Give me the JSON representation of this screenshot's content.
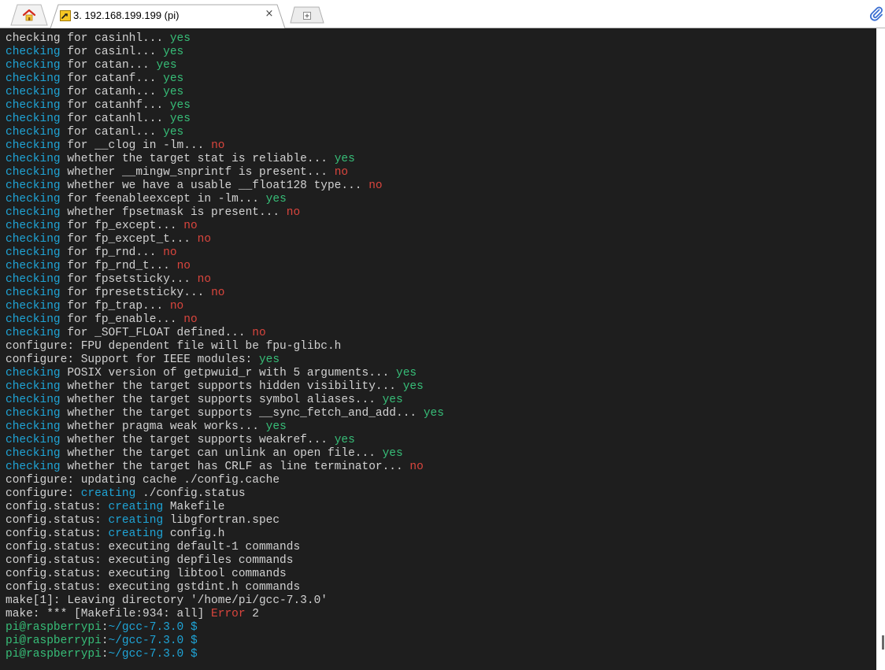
{
  "window": {
    "tab_title": "3. 192.168.199.199 (pi)",
    "close_glyph": "×",
    "icons": {
      "home": "home-icon",
      "session": "terminal-session-icon",
      "new_tab": "new-tab-icon",
      "attach": "paperclip-icon"
    }
  },
  "colors": {
    "background": "#1e1e1e",
    "text": "#d2d2d2",
    "keyword": "#1fa4d6",
    "yes": "#37be78",
    "no": "#d9453d"
  },
  "terminal": {
    "lines": [
      [
        {
          "t": "checking",
          "c": "plain"
        },
        {
          "t": " for casinhl... ",
          "c": "plain"
        },
        {
          "t": "yes",
          "c": "yes"
        }
      ],
      [
        {
          "t": "checking",
          "c": "kw"
        },
        {
          "t": " for casinl... ",
          "c": "plain"
        },
        {
          "t": "yes",
          "c": "yes"
        }
      ],
      [
        {
          "t": "checking",
          "c": "kw"
        },
        {
          "t": " for catan... ",
          "c": "plain"
        },
        {
          "t": "yes",
          "c": "yes"
        }
      ],
      [
        {
          "t": "checking",
          "c": "kw"
        },
        {
          "t": " for catanf... ",
          "c": "plain"
        },
        {
          "t": "yes",
          "c": "yes"
        }
      ],
      [
        {
          "t": "checking",
          "c": "kw"
        },
        {
          "t": " for catanh... ",
          "c": "plain"
        },
        {
          "t": "yes",
          "c": "yes"
        }
      ],
      [
        {
          "t": "checking",
          "c": "kw"
        },
        {
          "t": " for catanhf... ",
          "c": "plain"
        },
        {
          "t": "yes",
          "c": "yes"
        }
      ],
      [
        {
          "t": "checking",
          "c": "kw"
        },
        {
          "t": " for catanhl... ",
          "c": "plain"
        },
        {
          "t": "yes",
          "c": "yes"
        }
      ],
      [
        {
          "t": "checking",
          "c": "kw"
        },
        {
          "t": " for catanl... ",
          "c": "plain"
        },
        {
          "t": "yes",
          "c": "yes"
        }
      ],
      [
        {
          "t": "checking",
          "c": "kw"
        },
        {
          "t": " for __clog in -lm... ",
          "c": "plain"
        },
        {
          "t": "no",
          "c": "no"
        }
      ],
      [
        {
          "t": "checking",
          "c": "kw"
        },
        {
          "t": " whether the target stat is reliable... ",
          "c": "plain"
        },
        {
          "t": "yes",
          "c": "yes"
        }
      ],
      [
        {
          "t": "checking",
          "c": "kw"
        },
        {
          "t": " whether __mingw_snprintf is present... ",
          "c": "plain"
        },
        {
          "t": "no",
          "c": "no"
        }
      ],
      [
        {
          "t": "checking",
          "c": "kw"
        },
        {
          "t": " whether we have a usable __float128 type... ",
          "c": "plain"
        },
        {
          "t": "no",
          "c": "no"
        }
      ],
      [
        {
          "t": "checking",
          "c": "kw"
        },
        {
          "t": " for feenableexcept in -lm... ",
          "c": "plain"
        },
        {
          "t": "yes",
          "c": "yes"
        }
      ],
      [
        {
          "t": "checking",
          "c": "kw"
        },
        {
          "t": " whether fpsetmask is present... ",
          "c": "plain"
        },
        {
          "t": "no",
          "c": "no"
        }
      ],
      [
        {
          "t": "checking",
          "c": "kw"
        },
        {
          "t": " for fp_except... ",
          "c": "plain"
        },
        {
          "t": "no",
          "c": "no"
        }
      ],
      [
        {
          "t": "checking",
          "c": "kw"
        },
        {
          "t": " for fp_except_t... ",
          "c": "plain"
        },
        {
          "t": "no",
          "c": "no"
        }
      ],
      [
        {
          "t": "checking",
          "c": "kw"
        },
        {
          "t": " for fp_rnd... ",
          "c": "plain"
        },
        {
          "t": "no",
          "c": "no"
        }
      ],
      [
        {
          "t": "checking",
          "c": "kw"
        },
        {
          "t": " for fp_rnd_t... ",
          "c": "plain"
        },
        {
          "t": "no",
          "c": "no"
        }
      ],
      [
        {
          "t": "checking",
          "c": "kw"
        },
        {
          "t": " for fpsetsticky... ",
          "c": "plain"
        },
        {
          "t": "no",
          "c": "no"
        }
      ],
      [
        {
          "t": "checking",
          "c": "kw"
        },
        {
          "t": " for fpresetsticky... ",
          "c": "plain"
        },
        {
          "t": "no",
          "c": "no"
        }
      ],
      [
        {
          "t": "checking",
          "c": "kw"
        },
        {
          "t": " for fp_trap... ",
          "c": "plain"
        },
        {
          "t": "no",
          "c": "no"
        }
      ],
      [
        {
          "t": "checking",
          "c": "kw"
        },
        {
          "t": " for fp_enable... ",
          "c": "plain"
        },
        {
          "t": "no",
          "c": "no"
        }
      ],
      [
        {
          "t": "checking",
          "c": "kw"
        },
        {
          "t": " for _SOFT_FLOAT defined... ",
          "c": "plain"
        },
        {
          "t": "no",
          "c": "no"
        }
      ],
      [
        {
          "t": "configure: FPU dependent file will be fpu-glibc.h",
          "c": "plain"
        }
      ],
      [
        {
          "t": "configure: Support for IEEE modules: ",
          "c": "plain"
        },
        {
          "t": "yes",
          "c": "yes"
        }
      ],
      [
        {
          "t": "checking",
          "c": "kw"
        },
        {
          "t": " POSIX version of getpwuid_r with 5 arguments... ",
          "c": "plain"
        },
        {
          "t": "yes",
          "c": "yes"
        }
      ],
      [
        {
          "t": "checking",
          "c": "kw"
        },
        {
          "t": " whether the target supports hidden visibility... ",
          "c": "plain"
        },
        {
          "t": "yes",
          "c": "yes"
        }
      ],
      [
        {
          "t": "checking",
          "c": "kw"
        },
        {
          "t": " whether the target supports symbol aliases... ",
          "c": "plain"
        },
        {
          "t": "yes",
          "c": "yes"
        }
      ],
      [
        {
          "t": "checking",
          "c": "kw"
        },
        {
          "t": " whether the target supports __sync_fetch_and_add... ",
          "c": "plain"
        },
        {
          "t": "yes",
          "c": "yes"
        }
      ],
      [
        {
          "t": "checking",
          "c": "kw"
        },
        {
          "t": " whether pragma weak works... ",
          "c": "plain"
        },
        {
          "t": "yes",
          "c": "yes"
        }
      ],
      [
        {
          "t": "checking",
          "c": "kw"
        },
        {
          "t": " whether the target supports weakref... ",
          "c": "plain"
        },
        {
          "t": "yes",
          "c": "yes"
        }
      ],
      [
        {
          "t": "checking",
          "c": "kw"
        },
        {
          "t": " whether the target can unlink an open file... ",
          "c": "plain"
        },
        {
          "t": "yes",
          "c": "yes"
        }
      ],
      [
        {
          "t": "checking",
          "c": "kw"
        },
        {
          "t": " whether the target has CRLF as line terminator... ",
          "c": "plain"
        },
        {
          "t": "no",
          "c": "no"
        }
      ],
      [
        {
          "t": "configure: updating cache ./config.cache",
          "c": "plain"
        }
      ],
      [
        {
          "t": "configure: ",
          "c": "plain"
        },
        {
          "t": "creating",
          "c": "kw"
        },
        {
          "t": " ./config.status",
          "c": "plain"
        }
      ],
      [
        {
          "t": "config.status: ",
          "c": "plain"
        },
        {
          "t": "creating",
          "c": "kw"
        },
        {
          "t": " Makefile",
          "c": "plain"
        }
      ],
      [
        {
          "t": "config.status: ",
          "c": "plain"
        },
        {
          "t": "creating",
          "c": "kw"
        },
        {
          "t": " libgfortran.spec",
          "c": "plain"
        }
      ],
      [
        {
          "t": "config.status: ",
          "c": "plain"
        },
        {
          "t": "creating",
          "c": "kw"
        },
        {
          "t": " config.h",
          "c": "plain"
        }
      ],
      [
        {
          "t": "config.status: executing default-1 commands",
          "c": "plain"
        }
      ],
      [
        {
          "t": "config.status: executing depfiles commands",
          "c": "plain"
        }
      ],
      [
        {
          "t": "config.status: executing libtool commands",
          "c": "plain"
        }
      ],
      [
        {
          "t": "config.status: executing gstdint.h commands",
          "c": "plain"
        }
      ],
      [
        {
          "t": "make[1]: Leaving directory '/home/pi/gcc-7.3.0'",
          "c": "plain"
        }
      ],
      [
        {
          "t": "make: *** [Makefile:934: all] ",
          "c": "plain"
        },
        {
          "t": "Error",
          "c": "no"
        },
        {
          "t": " 2",
          "c": "plain"
        }
      ],
      [
        {
          "t": "pi@raspberrypi",
          "c": "yes"
        },
        {
          "t": ":",
          "c": "plain"
        },
        {
          "t": "~/gcc-7.3.0 $",
          "c": "kw"
        }
      ],
      [
        {
          "t": "pi@raspberrypi",
          "c": "yes"
        },
        {
          "t": ":",
          "c": "plain"
        },
        {
          "t": "~/gcc-7.3.0 $",
          "c": "kw"
        }
      ],
      [
        {
          "t": "pi@raspberrypi",
          "c": "yes"
        },
        {
          "t": ":",
          "c": "plain"
        },
        {
          "t": "~/gcc-7.3.0 $",
          "c": "kw"
        }
      ]
    ]
  }
}
